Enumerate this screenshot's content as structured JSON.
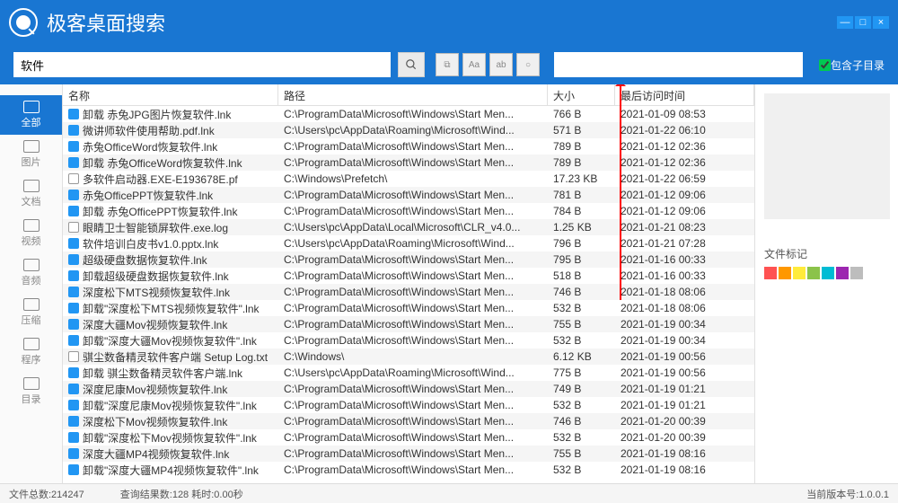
{
  "title": "极客桌面搜索",
  "window_controls": {
    "min": "—",
    "max": "□",
    "close": "×"
  },
  "search": {
    "value": "软件",
    "placeholder": "",
    "filter_placeholder": ""
  },
  "subdir_label": "包含子目录",
  "sidebar": {
    "items": [
      {
        "label": "全部"
      },
      {
        "label": "图片"
      },
      {
        "label": "文档"
      },
      {
        "label": "视频"
      },
      {
        "label": "音频"
      },
      {
        "label": "压缩"
      },
      {
        "label": "程序"
      },
      {
        "label": "目录"
      }
    ]
  },
  "columns": {
    "name": "名称",
    "path": "路径",
    "size": "大小",
    "time": "最后访问时间"
  },
  "rows": [
    {
      "icon": "doc",
      "name": "卸载 赤兔JPG图片恢复软件.lnk",
      "path": "C:\\ProgramData\\Microsoft\\Windows\\Start Men...",
      "size": "766 B",
      "time": "2021-01-09 08:53"
    },
    {
      "icon": "doc",
      "name": "微讲师软件使用帮助.pdf.lnk",
      "path": "C:\\Users\\pc\\AppData\\Roaming\\Microsoft\\Wind...",
      "size": "571 B",
      "time": "2021-01-22 06:10"
    },
    {
      "icon": "doc",
      "name": "赤兔OfficeWord恢复软件.lnk",
      "path": "C:\\ProgramData\\Microsoft\\Windows\\Start Men...",
      "size": "789 B",
      "time": "2021-01-12 02:36"
    },
    {
      "icon": "doc",
      "name": "卸载 赤兔OfficeWord恢复软件.lnk",
      "path": "C:\\ProgramData\\Microsoft\\Windows\\Start Men...",
      "size": "789 B",
      "time": "2021-01-12 02:36"
    },
    {
      "icon": "txt",
      "name": "多软件启动器.EXE-E193678E.pf",
      "path": "C:\\Windows\\Prefetch\\",
      "size": "17.23 KB",
      "time": "2021-01-22 06:59"
    },
    {
      "icon": "doc",
      "name": "赤兔OfficePPT恢复软件.lnk",
      "path": "C:\\ProgramData\\Microsoft\\Windows\\Start Men...",
      "size": "781 B",
      "time": "2021-01-12 09:06"
    },
    {
      "icon": "doc",
      "name": "卸载 赤兔OfficePPT恢复软件.lnk",
      "path": "C:\\ProgramData\\Microsoft\\Windows\\Start Men...",
      "size": "784 B",
      "time": "2021-01-12 09:06"
    },
    {
      "icon": "txt",
      "name": "眼睛卫士智能锁屏软件.exe.log",
      "path": "C:\\Users\\pc\\AppData\\Local\\Microsoft\\CLR_v4.0...",
      "size": "1.25 KB",
      "time": "2021-01-21 08:23"
    },
    {
      "icon": "doc",
      "name": "软件培训白皮书v1.0.pptx.lnk",
      "path": "C:\\Users\\pc\\AppData\\Roaming\\Microsoft\\Wind...",
      "size": "796 B",
      "time": "2021-01-21 07:28"
    },
    {
      "icon": "doc",
      "name": "超级硬盘数据恢复软件.lnk",
      "path": "C:\\ProgramData\\Microsoft\\Windows\\Start Men...",
      "size": "795 B",
      "time": "2021-01-16 00:33"
    },
    {
      "icon": "doc",
      "name": "卸载超级硬盘数据恢复软件.lnk",
      "path": "C:\\ProgramData\\Microsoft\\Windows\\Start Men...",
      "size": "518 B",
      "time": "2021-01-16 00:33"
    },
    {
      "icon": "doc",
      "name": "深度松下MTS视频恢复软件.lnk",
      "path": "C:\\ProgramData\\Microsoft\\Windows\\Start Men...",
      "size": "746 B",
      "time": "2021-01-18 08:06"
    },
    {
      "icon": "doc",
      "name": "卸载\"深度松下MTS视频恢复软件\".lnk",
      "path": "C:\\ProgramData\\Microsoft\\Windows\\Start Men...",
      "size": "532 B",
      "time": "2021-01-18 08:06"
    },
    {
      "icon": "doc",
      "name": "深度大疆Mov视频恢复软件.lnk",
      "path": "C:\\ProgramData\\Microsoft\\Windows\\Start Men...",
      "size": "755 B",
      "time": "2021-01-19 00:34"
    },
    {
      "icon": "doc",
      "name": "卸载\"深度大疆Mov视频恢复软件\".lnk",
      "path": "C:\\ProgramData\\Microsoft\\Windows\\Start Men...",
      "size": "532 B",
      "time": "2021-01-19 00:34"
    },
    {
      "icon": "txt",
      "name": "骐尘数备精灵软件客户端 Setup Log.txt",
      "path": "C:\\Windows\\",
      "size": "6.12 KB",
      "time": "2021-01-19 00:56"
    },
    {
      "icon": "doc",
      "name": "卸载 骐尘数备精灵软件客户端.lnk",
      "path": "C:\\Users\\pc\\AppData\\Roaming\\Microsoft\\Wind...",
      "size": "775 B",
      "time": "2021-01-19 00:56"
    },
    {
      "icon": "doc",
      "name": "深度尼康Mov视频恢复软件.lnk",
      "path": "C:\\ProgramData\\Microsoft\\Windows\\Start Men...",
      "size": "749 B",
      "time": "2021-01-19 01:21"
    },
    {
      "icon": "doc",
      "name": "卸载\"深度尼康Mov视频恢复软件\".lnk",
      "path": "C:\\ProgramData\\Microsoft\\Windows\\Start Men...",
      "size": "532 B",
      "time": "2021-01-19 01:21"
    },
    {
      "icon": "doc",
      "name": "深度松下Mov视频恢复软件.lnk",
      "path": "C:\\ProgramData\\Microsoft\\Windows\\Start Men...",
      "size": "746 B",
      "time": "2021-01-20 00:39"
    },
    {
      "icon": "doc",
      "name": "卸载\"深度松下Mov视频恢复软件\".lnk",
      "path": "C:\\ProgramData\\Microsoft\\Windows\\Start Men...",
      "size": "532 B",
      "time": "2021-01-20 00:39"
    },
    {
      "icon": "doc",
      "name": "深度大疆MP4视频恢复软件.lnk",
      "path": "C:\\ProgramData\\Microsoft\\Windows\\Start Men...",
      "size": "755 B",
      "time": "2021-01-19 08:16"
    },
    {
      "icon": "doc",
      "name": "卸载\"深度大疆MP4视频恢复软件\".lnk",
      "path": "C:\\ProgramData\\Microsoft\\Windows\\Start Men...",
      "size": "532 B",
      "time": "2021-01-19 08:16"
    }
  ],
  "tags_title": "文件标记",
  "tag_colors": [
    "#ff5252",
    "#ff9800",
    "#ffeb3b",
    "#8bc34a",
    "#00bcd4",
    "#9c27b0",
    "#bdbdbd"
  ],
  "status": {
    "total_label": "文件总数:214247",
    "result_label": "查询结果数:128 耗时:0.00秒",
    "version_label": "当前版本号:1.0.0.1"
  }
}
